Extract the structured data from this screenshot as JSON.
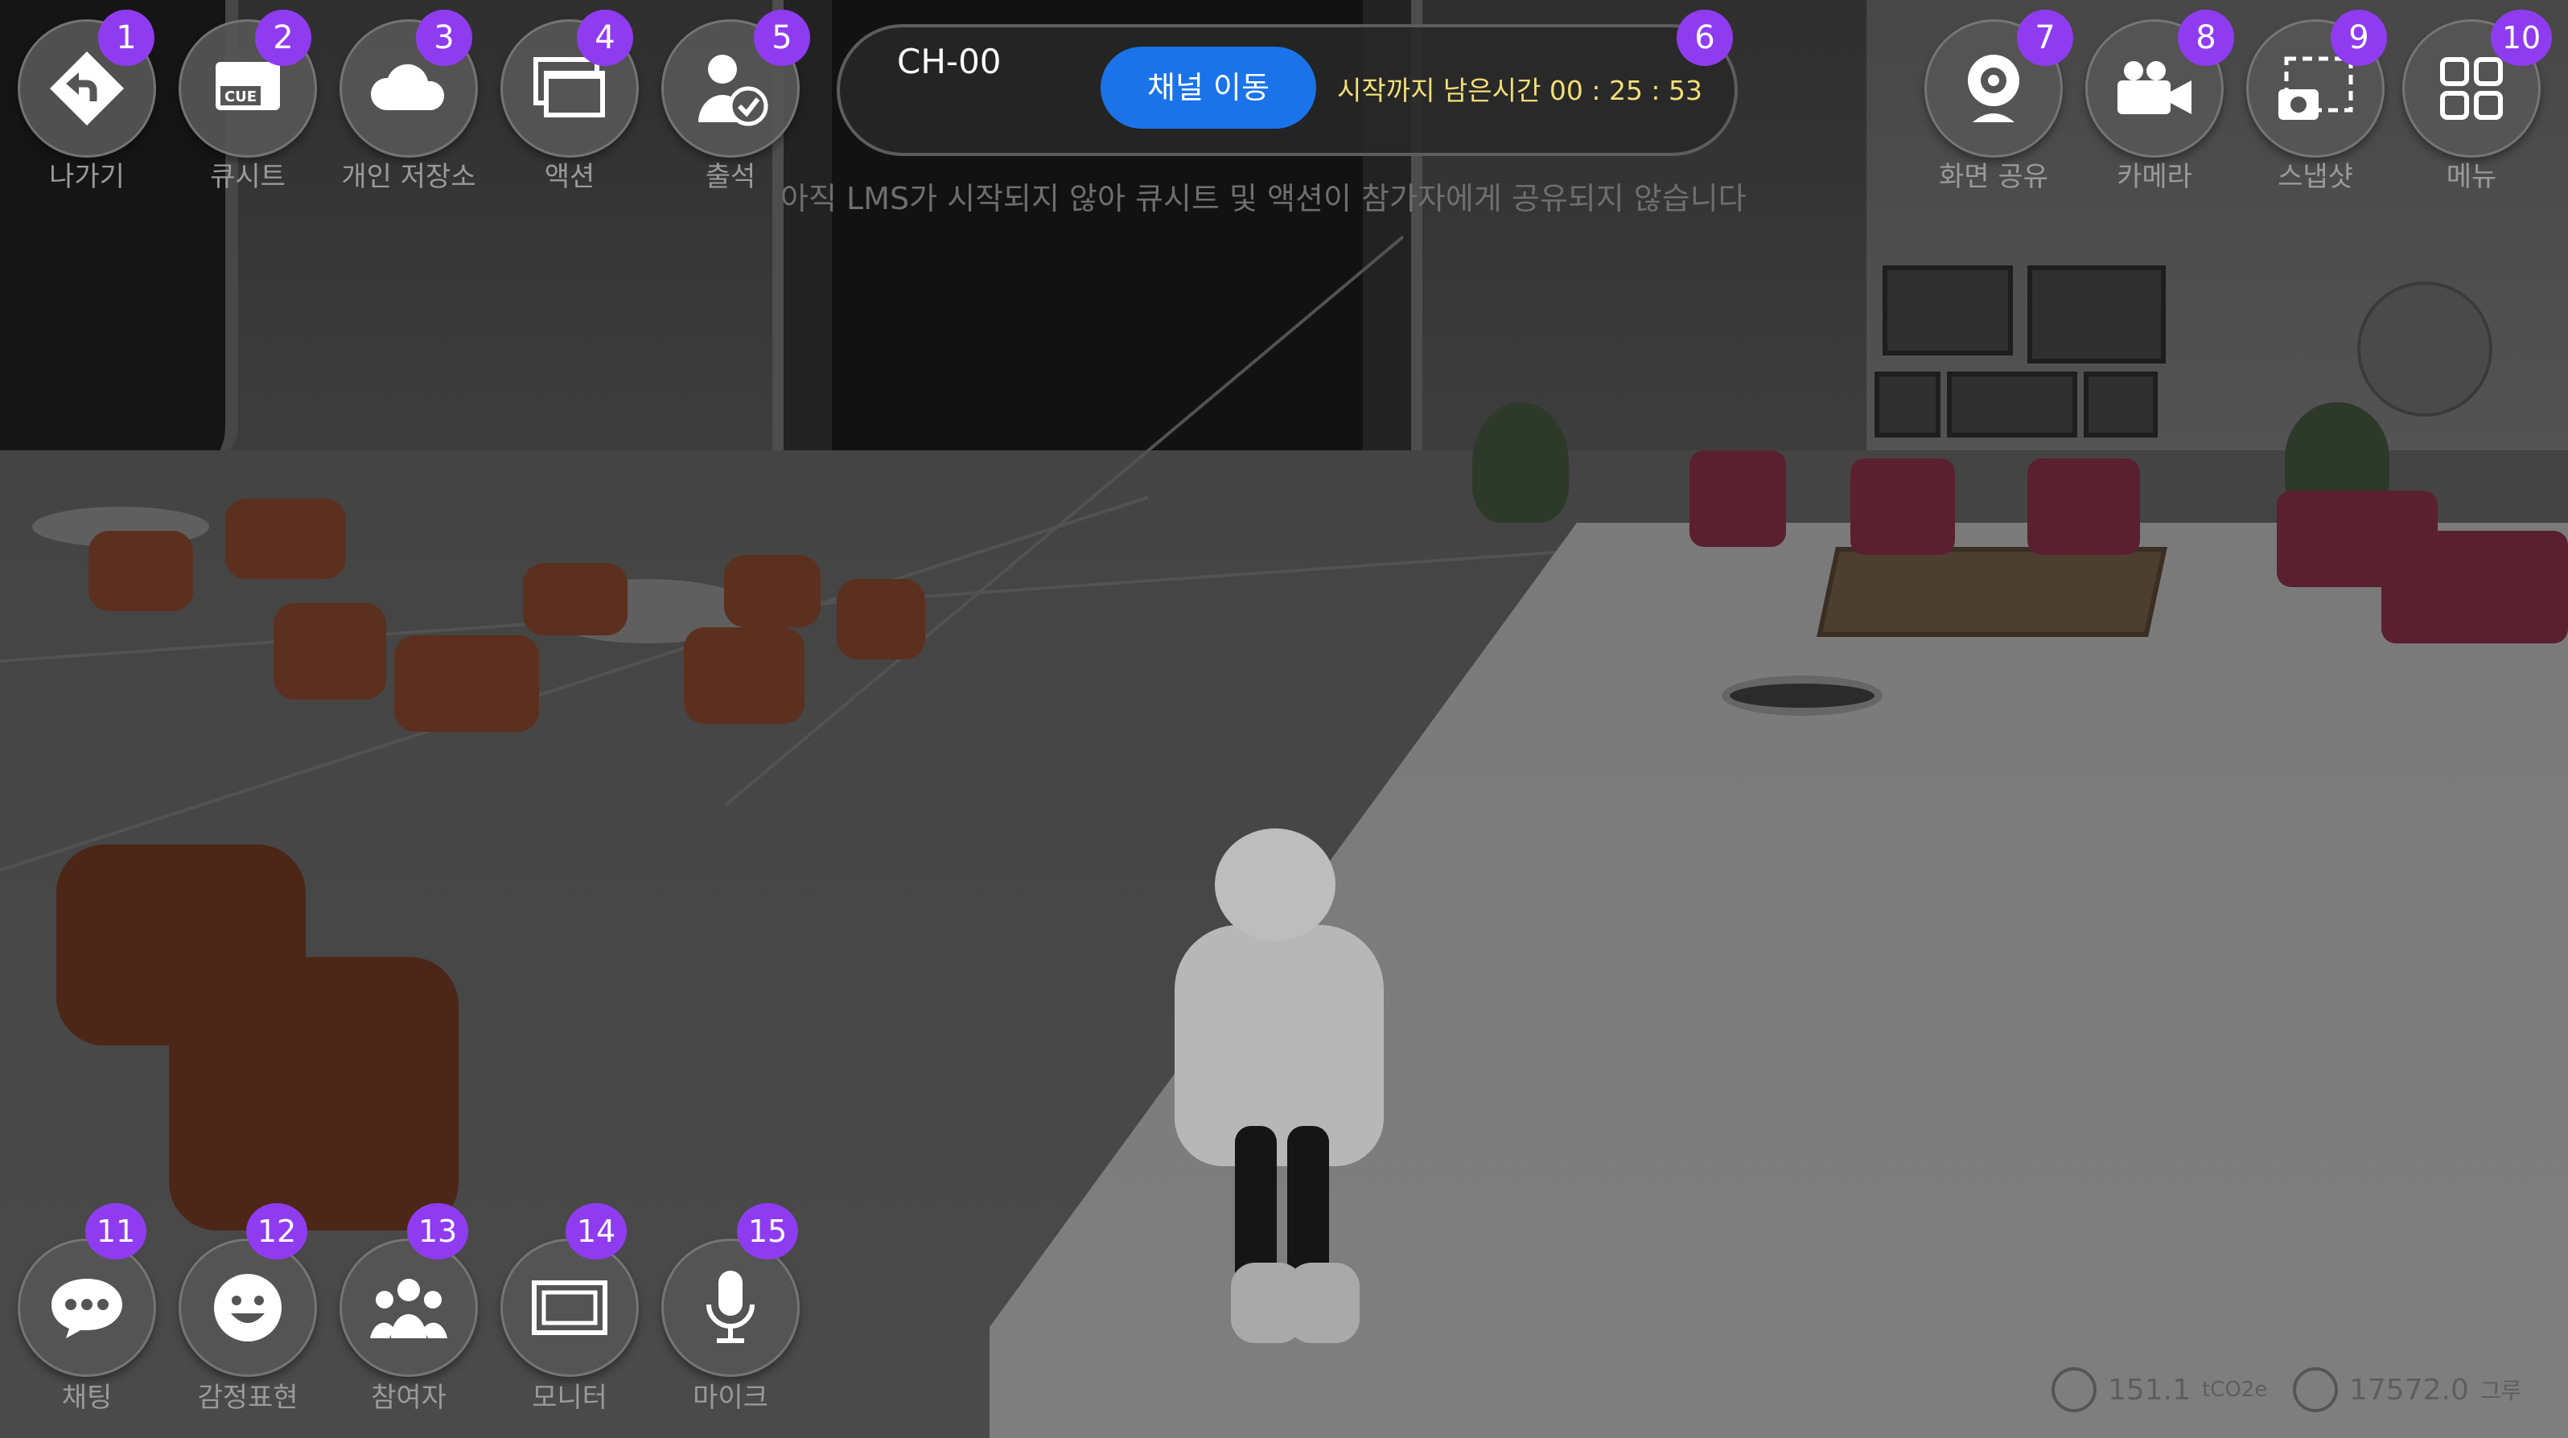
{
  "topbar": {
    "buttons": [
      {
        "id": 1,
        "label": "나가기",
        "icon": "exit-arrow-icon"
      },
      {
        "id": 2,
        "label": "큐시트",
        "icon": "cue-sheet-icon"
      },
      {
        "id": 3,
        "label": "개인 저장소",
        "icon": "cloud-icon"
      },
      {
        "id": 4,
        "label": "액션",
        "icon": "window-stack-icon"
      },
      {
        "id": 5,
        "label": "출석",
        "icon": "user-check-icon"
      }
    ],
    "right_buttons": [
      {
        "id": 7,
        "label": "화면 공유",
        "icon": "webcam-icon"
      },
      {
        "id": 8,
        "label": "카메라",
        "icon": "video-camera-icon"
      },
      {
        "id": 9,
        "label": "스냅샷",
        "icon": "snapshot-icon"
      },
      {
        "id": 10,
        "label": "메뉴",
        "icon": "grid-menu-icon"
      }
    ]
  },
  "channel": {
    "badge": 6,
    "name": "CH-00",
    "move_button": "채널 이동",
    "timer_text": "시작까지 남은시간 00 : 25 : 53"
  },
  "notice": "아직 LMS가 시작되지 않아 큐시트 및 액션이 참가자에게 공유되지 않습니다",
  "bottombar": {
    "buttons": [
      {
        "id": 11,
        "label": "채팅",
        "icon": "chat-bubble-icon"
      },
      {
        "id": 12,
        "label": "감정표현",
        "icon": "smile-icon"
      },
      {
        "id": 13,
        "label": "참여자",
        "icon": "participants-icon"
      },
      {
        "id": 14,
        "label": "모니터",
        "icon": "monitor-icon"
      },
      {
        "id": 15,
        "label": "마이크",
        "icon": "microphone-icon"
      }
    ]
  },
  "stats": {
    "co2_value": "151.1",
    "co2_unit": "tCO2e",
    "tree_value": "17572.0",
    "tree_unit": "그루"
  },
  "colors": {
    "badge": "#8f3cf0",
    "primary_button": "#1a73e8",
    "timer_text": "#f3df76"
  }
}
